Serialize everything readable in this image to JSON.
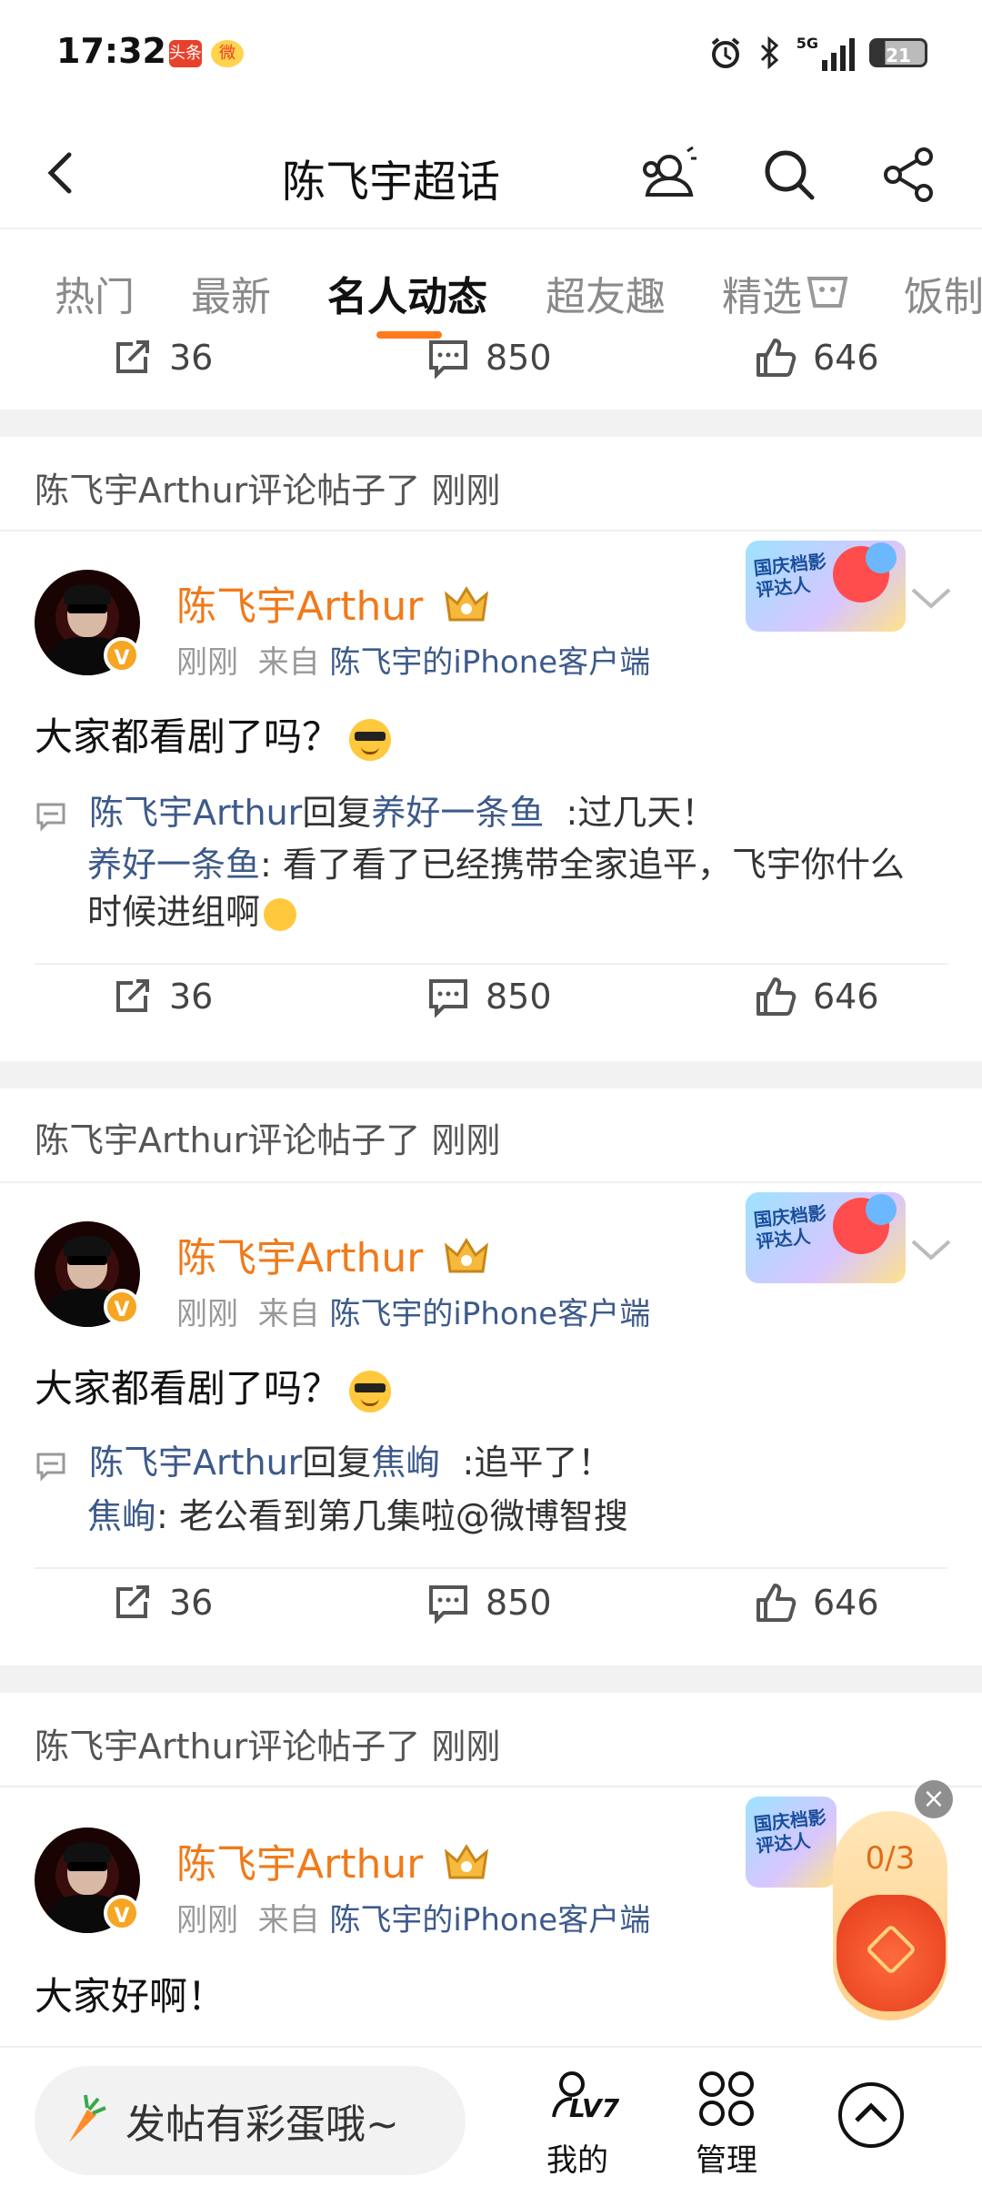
{
  "status_bar": {
    "time": "17:32",
    "app1": "头条",
    "app2": "微",
    "network": "5G",
    "battery": "21"
  },
  "header": {
    "title": "陈飞宇超话"
  },
  "tabs": [
    "热门",
    "最新",
    "名人动态",
    "超友趣",
    "精选",
    "饭制"
  ],
  "active_tab": 2,
  "top_actions": {
    "repost": "36",
    "comment": "850",
    "like": "646"
  },
  "posts": [
    {
      "caption": "陈飞宇Arthur评论帖子了 刚刚",
      "user": "陈飞宇Arthur",
      "time": "刚刚",
      "from_label": "来自",
      "source": "陈飞宇的iPhone客户端",
      "sticker": "国庆档影评达人",
      "text": "大家都看剧了吗？",
      "reply_user": "陈飞宇Arthur",
      "reply_word": "回复",
      "reply_to": "养好一条鱼",
      "reply_text": ":过几天！",
      "quote_user": "养好一条鱼",
      "quote_text": ": 看了看了已经携带全家追平，飞宇你什么时候进组啊",
      "repost": "36",
      "comment": "850",
      "like": "646"
    },
    {
      "caption": "陈飞宇Arthur评论帖子了 刚刚",
      "user": "陈飞宇Arthur",
      "time": "刚刚",
      "from_label": "来自",
      "source": "陈飞宇的iPhone客户端",
      "sticker": "国庆档影评达人",
      "text": "大家都看剧了吗？",
      "reply_user": "陈飞宇Arthur",
      "reply_word": "回复",
      "reply_to": "焦峋",
      "reply_text": ":追平了！",
      "quote_user": "焦峋",
      "quote_text": ": 老公看到第几集啦@微博智搜",
      "repost": "36",
      "comment": "850",
      "like": "646"
    },
    {
      "caption": "陈飞宇Arthur评论帖子了 刚刚",
      "user": "陈飞宇Arthur",
      "time": "刚刚",
      "from_label": "来自",
      "source": "陈飞宇的iPhone客户端",
      "sticker": "国庆档影评达人",
      "text": "大家好啊！"
    }
  ],
  "floating_reward": {
    "count": "0/3",
    "close": "×"
  },
  "bottom_bar": {
    "compose_placeholder": "发帖有彩蛋哦~",
    "level_badge": "LV7",
    "mine_label": "我的",
    "manage_label": "管理"
  },
  "colors": {
    "accent": "#ff7a1a",
    "username": "#f07a1a",
    "link": "#3d5a8a"
  },
  "icons": [
    "back-icon",
    "user-group-icon",
    "search-icon",
    "share-icon",
    "repost-icon",
    "comment-icon",
    "like-icon",
    "crown-icon",
    "chevron-down-icon",
    "reply-icon",
    "carrot-icon",
    "profile-icon",
    "grid-icon",
    "scroll-top-icon",
    "close-icon"
  ]
}
